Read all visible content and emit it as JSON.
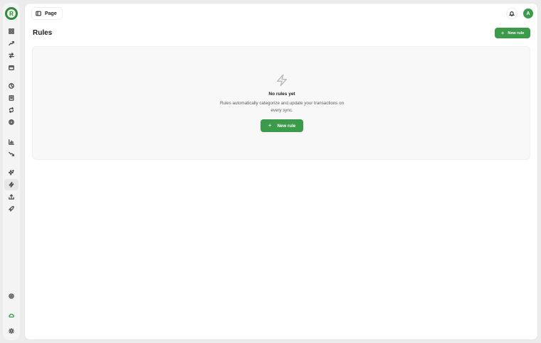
{
  "logo": {
    "name": "logo-icon",
    "letter": "R"
  },
  "rail": {
    "items": [
      {
        "name": "dashboard-icon"
      },
      {
        "name": "trending-up-icon"
      },
      {
        "name": "transfer-icon"
      },
      {
        "name": "wallet-icon"
      },
      {
        "name": "clock-icon"
      },
      {
        "name": "receipt-icon"
      },
      {
        "name": "repeat-icon"
      },
      {
        "name": "target-icon"
      },
      {
        "name": "bar-chart-icon"
      },
      {
        "name": "trending-down-icon"
      },
      {
        "name": "sparkles-icon"
      },
      {
        "name": "zap-icon",
        "active": true
      },
      {
        "name": "upload-icon"
      },
      {
        "name": "rocket-icon"
      }
    ],
    "bottom": [
      {
        "name": "settings-icon"
      },
      {
        "name": "cloud-icon",
        "color": "#3a9a4a"
      },
      {
        "name": "sun-icon"
      }
    ]
  },
  "header": {
    "breadcrumb_label": "Page",
    "avatar_initial": "A"
  },
  "page": {
    "title": "Rules",
    "new_rule_label": "New rule"
  },
  "empty_state": {
    "heading": "No rules yet",
    "description": "Rules automatically categorize and update your transactions on every sync.",
    "button_label": "New rule"
  },
  "colors": {
    "accent": "#3c9a4b",
    "surface": "#ffffff",
    "background": "#ececec"
  }
}
